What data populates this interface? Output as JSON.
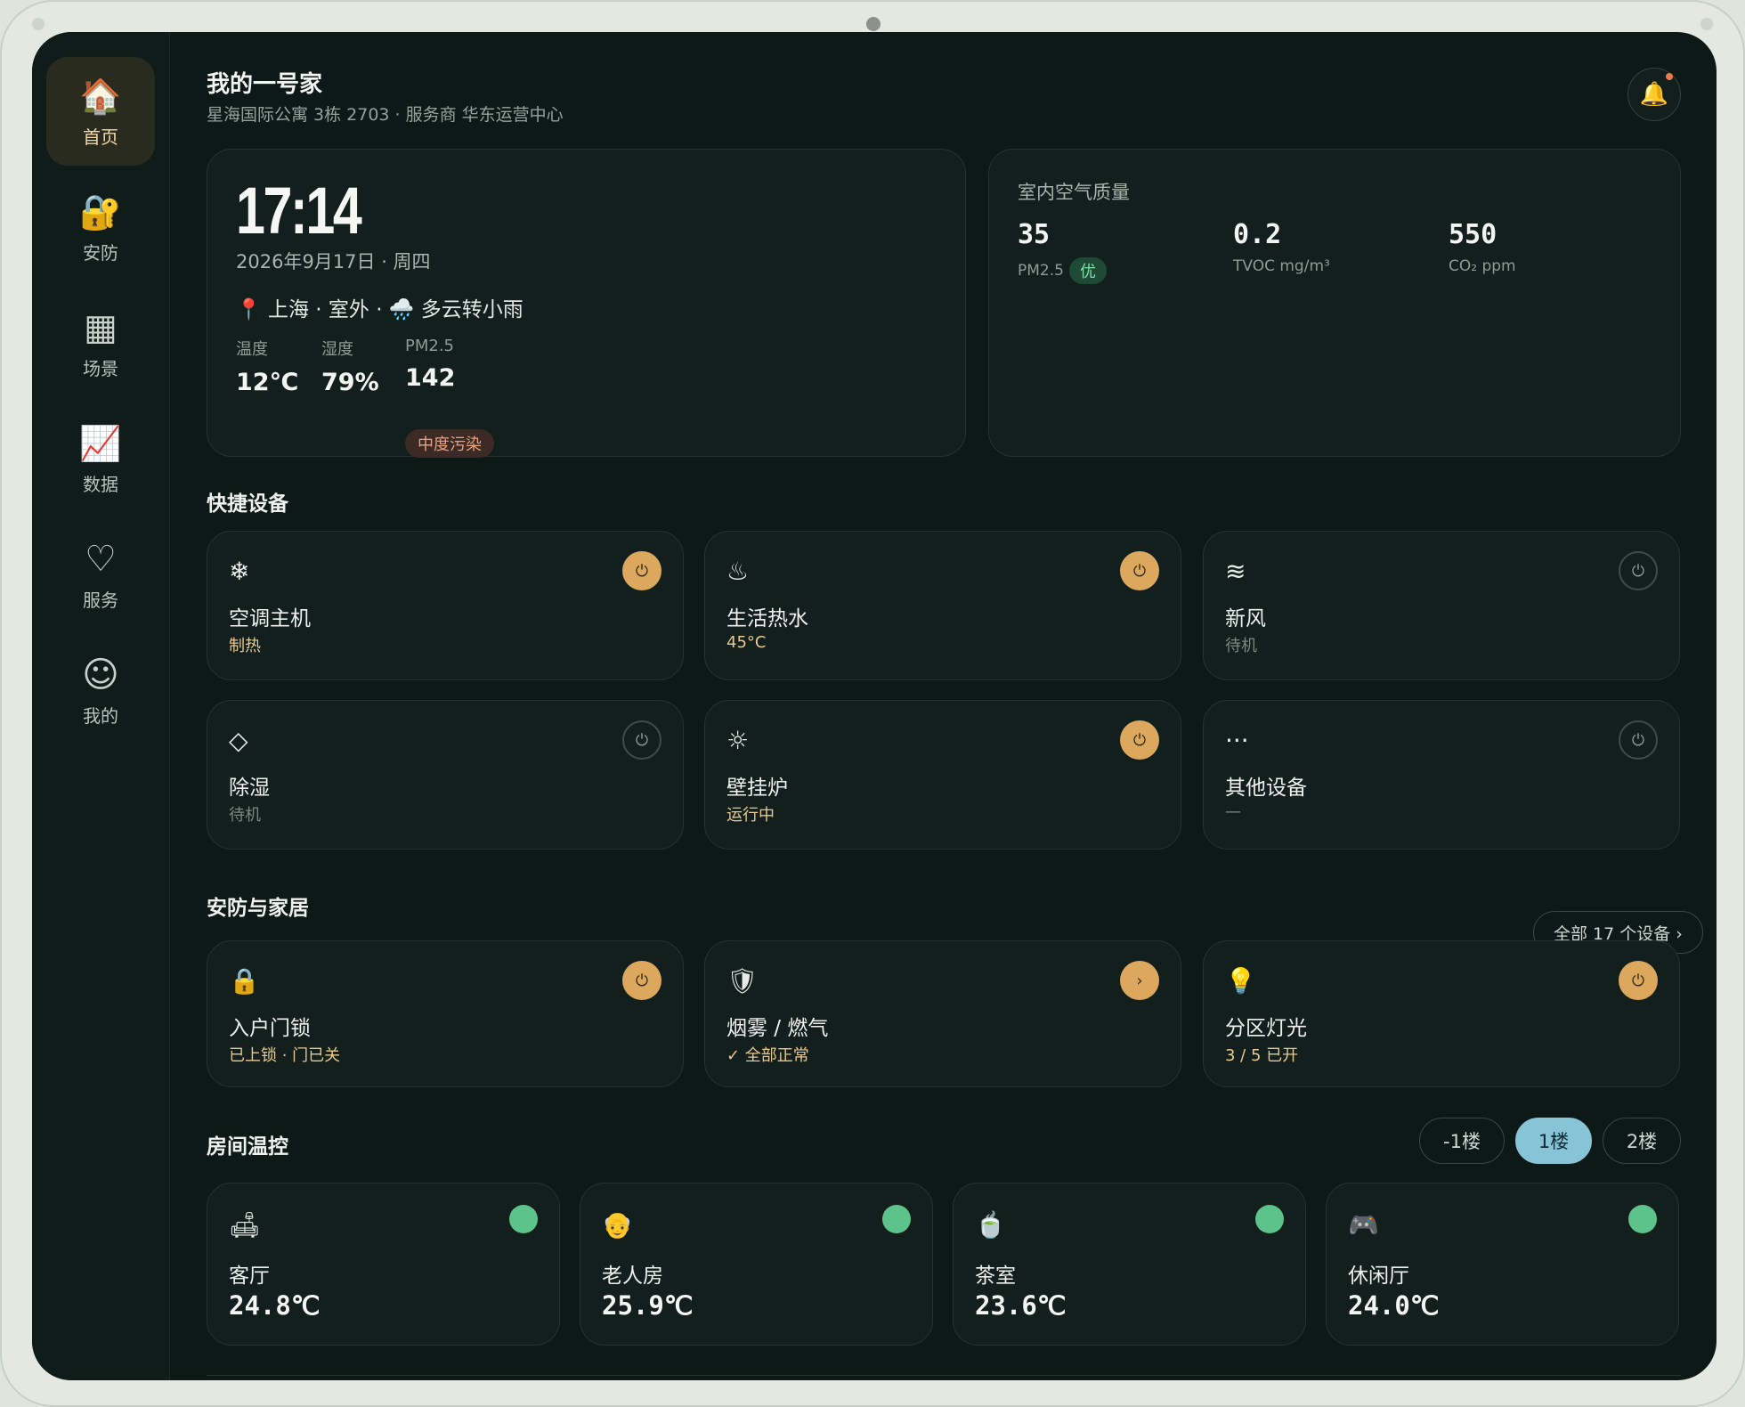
{
  "header": {
    "title": "我的一号家",
    "subtitle": "星海国际公寓 3栋 2703 · 服务商 华东运营中心"
  },
  "sidebar": {
    "items": [
      {
        "label": "首页",
        "icon": "home-icon",
        "glyph": "🏠",
        "active": true
      },
      {
        "label": "安防",
        "icon": "lock-icon",
        "glyph": "🔐",
        "active": false
      },
      {
        "label": "场景",
        "icon": "grid-icon",
        "glyph": "▦",
        "active": false
      },
      {
        "label": "数据",
        "icon": "chart-icon",
        "glyph": "📈",
        "active": false
      },
      {
        "label": "服务",
        "icon": "heart-icon",
        "glyph": "♡",
        "active": false
      },
      {
        "label": "我的",
        "icon": "smile-icon",
        "glyph": "☺",
        "active": false
      }
    ]
  },
  "clock": {
    "time": "17:14",
    "date": "2026年9月17日 · 周四",
    "location": "📍 上海 · 室外 · 🌧️ 多云转小雨",
    "weather": [
      {
        "label": "温度",
        "value": "12℃"
      },
      {
        "label": "湿度",
        "value": "79%"
      },
      {
        "label": "PM2.5",
        "value": "142"
      }
    ],
    "pollution_badge": "中度污染"
  },
  "air": {
    "title": "室内空气质量",
    "metrics": [
      {
        "value": "35",
        "unit": "PM2.5",
        "badge": "优"
      },
      {
        "value": "0.2",
        "unit": "TVOC mg/m³"
      },
      {
        "value": "550",
        "unit": "CO₂ ppm"
      }
    ]
  },
  "quick": {
    "title": "快捷设备",
    "devices": [
      {
        "name": "空调主机",
        "status": "制热",
        "icon": "snowflake-icon",
        "glyph": "❄",
        "on": true
      },
      {
        "name": "生活热水",
        "status": "45°C",
        "icon": "hot-water-icon",
        "glyph": "♨",
        "on": true
      },
      {
        "name": "新风",
        "status": "待机",
        "icon": "wind-icon",
        "glyph": "≋",
        "on": false
      },
      {
        "name": "除湿",
        "status": "待机",
        "icon": "dehumidify-icon",
        "glyph": "◇",
        "on": false
      },
      {
        "name": "壁挂炉",
        "status": "运行中",
        "icon": "boiler-icon",
        "glyph": "☼",
        "on": true
      },
      {
        "name": "其他设备",
        "status": "—",
        "icon": "more-icon",
        "glyph": "···",
        "on": false
      }
    ]
  },
  "security": {
    "title": "安防与家居",
    "all_button": "全部 17 个设备 ›",
    "devices": [
      {
        "name": "入户门锁",
        "status": "已上锁 · 门已关",
        "icon": "lock-icon",
        "glyph": "🔒",
        "action": "⏻"
      },
      {
        "name": "烟雾 / 燃气",
        "status": "✓ 全部正常",
        "icon": "shield-icon",
        "glyph": "🛡",
        "action": "›"
      },
      {
        "name": "分区灯光",
        "status": "3 / 5 已开",
        "icon": "bulb-icon",
        "glyph": "💡",
        "action": "⏻"
      }
    ]
  },
  "rooms": {
    "title": "房间温控",
    "floors": [
      "-1楼",
      "1楼",
      "2楼"
    ],
    "active_floor": "1楼",
    "items": [
      {
        "name": "客厅",
        "temp": "24.8℃",
        "icon": "sofa-icon",
        "glyph": "🛋"
      },
      {
        "name": "老人房",
        "temp": "25.9℃",
        "icon": "elder-icon",
        "glyph": "👴"
      },
      {
        "name": "茶室",
        "temp": "23.6℃",
        "icon": "tea-icon",
        "glyph": "🍵"
      },
      {
        "name": "休闲厅",
        "temp": "24.0℃",
        "icon": "gamepad-icon",
        "glyph": "🎮"
      }
    ]
  },
  "colors": {
    "accent": "#dba85e",
    "room_status": "#5cc48a",
    "floor_active": "#86c4d6"
  }
}
